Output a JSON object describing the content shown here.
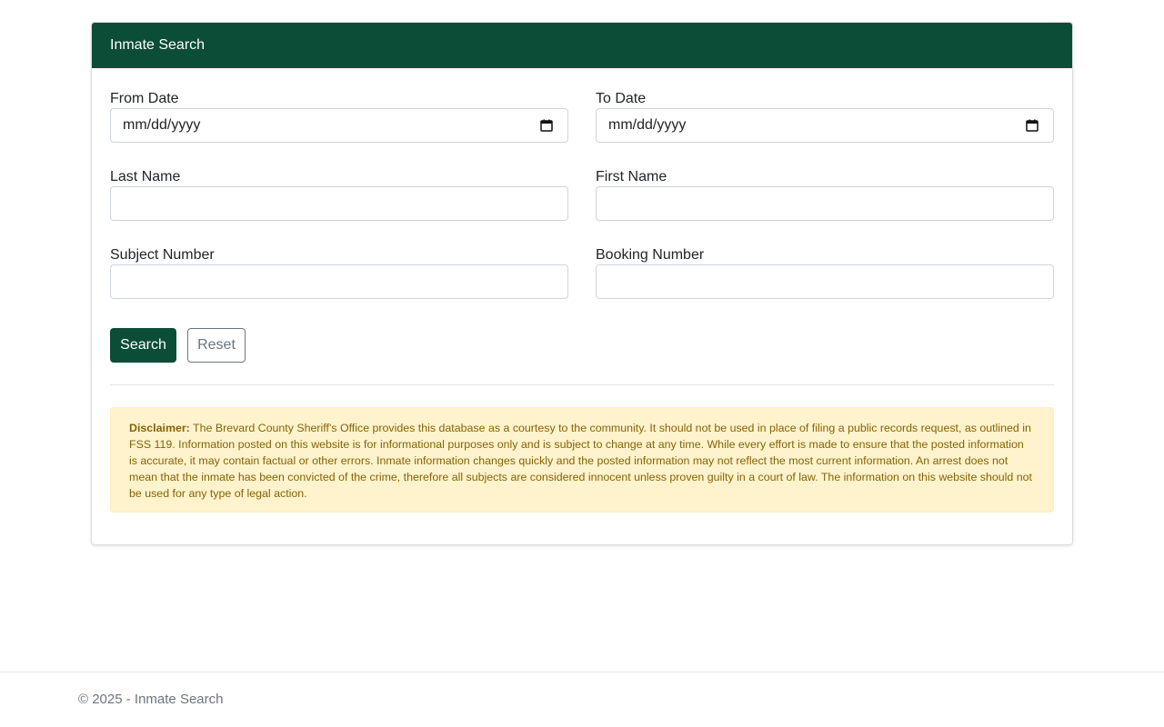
{
  "header": {
    "title": "Inmate Search"
  },
  "form": {
    "from_date": {
      "label": "From Date",
      "placeholder": "mm/dd/yyyy"
    },
    "to_date": {
      "label": "To Date",
      "placeholder": "mm/dd/yyyy"
    },
    "last_name": {
      "label": "Last Name",
      "value": ""
    },
    "first_name": {
      "label": "First Name",
      "value": ""
    },
    "subject_number": {
      "label": "Subject Number",
      "value": ""
    },
    "booking_number": {
      "label": "Booking Number",
      "value": ""
    },
    "search_label": "Search",
    "reset_label": "Reset"
  },
  "disclaimer": {
    "heading": "Disclaimer:",
    "text": "The Brevard County Sheriff's Office provides this database as a courtesy to the community. It should not be used in place of filing a public records request, as outlined in FSS 119. Information posted on this website is for informational purposes only and is subject to change at any time. While every effort is made to ensure that the posted information is accurate, it may contain factual or other errors. Inmate information changes quickly and the posted information may not reflect the most current information. An arrest does not mean that the inmate has been convicted of the crime, therefore all subjects are considered innocent unless proven guilty in a court of law. The information on this website should not be used for any type of legal action."
  },
  "footer": {
    "text": "© 2025 - Inmate Search"
  },
  "colors": {
    "brand_green": "#0b4d37",
    "disclaimer_bg": "#fff3cd",
    "disclaimer_text": "#856404"
  },
  "icons": {
    "date_picker": "calendar-icon"
  }
}
